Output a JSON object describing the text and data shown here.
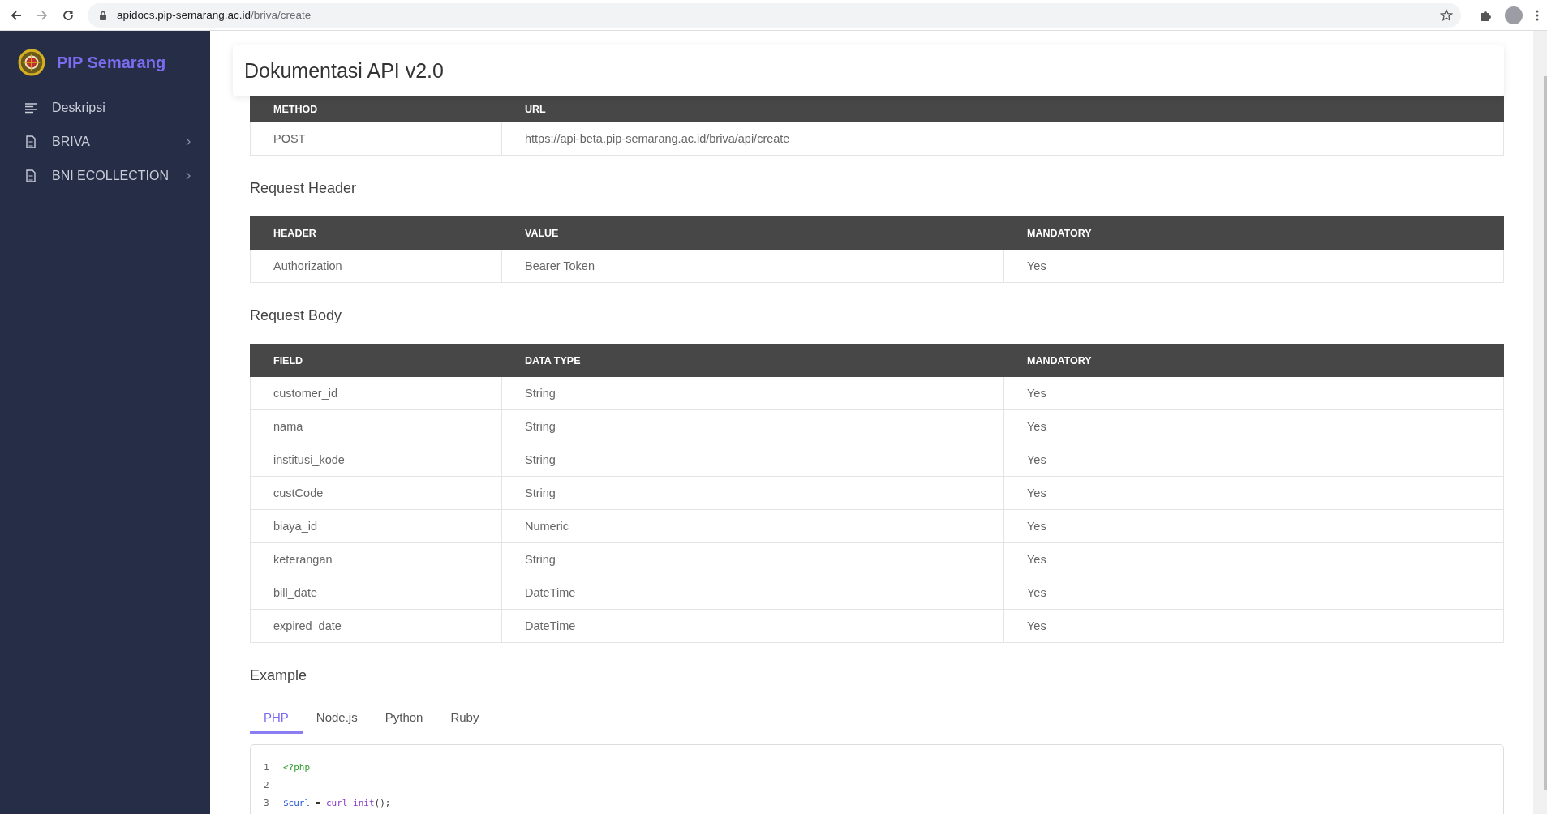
{
  "browser": {
    "url_host": "apidocs.pip-semarang.ac.id",
    "url_path": "/briva/create"
  },
  "sidebar": {
    "brand": "PIP Semarang",
    "items": [
      {
        "label": "Deskripsi",
        "kind": "lines",
        "expandable": false
      },
      {
        "label": "BRIVA",
        "kind": "doc",
        "expandable": true
      },
      {
        "label": "BNI ECOLLECTION",
        "kind": "doc",
        "expandable": true
      }
    ]
  },
  "header": {
    "title": "Dokumentasi API v2.0"
  },
  "sections": [
    {
      "columns": [
        "METHOD",
        "URL"
      ],
      "rows": [
        [
          "POST",
          "https://api-beta.pip-semarang.ac.id/briva/api/create"
        ]
      ]
    },
    {
      "title": "Request Header",
      "columns": [
        "HEADER",
        "VALUE",
        "MANDATORY"
      ],
      "rows": [
        [
          "Authorization",
          "Bearer Token",
          "Yes"
        ]
      ]
    },
    {
      "title": "Request Body",
      "columns": [
        "FIELD",
        "DATA TYPE",
        "MANDATORY"
      ],
      "rows": [
        [
          "customer_id",
          "String",
          "Yes"
        ],
        [
          "nama",
          "String",
          "Yes"
        ],
        [
          "institusi_kode",
          "String",
          "Yes"
        ],
        [
          "custCode",
          "String",
          "Yes"
        ],
        [
          "biaya_id",
          "Numeric",
          "Yes"
        ],
        [
          "keterangan",
          "String",
          "Yes"
        ],
        [
          "bill_date",
          "DateTime",
          "Yes"
        ],
        [
          "expired_date",
          "DateTime",
          "Yes"
        ]
      ]
    }
  ],
  "example": {
    "title": "Example",
    "tabs": [
      {
        "label": "PHP",
        "selected": true
      },
      {
        "label": "Node.js",
        "selected": false
      },
      {
        "label": "Python",
        "selected": false
      },
      {
        "label": "Ruby",
        "selected": false
      }
    ],
    "code": [
      {
        "number": "1",
        "tokens": [
          {
            "kind": "tag",
            "text": "<?php"
          }
        ]
      },
      {
        "number": "2"
      },
      {
        "number": "3",
        "tokens": [
          {
            "kind": "var",
            "text": "$curl"
          },
          {
            "kind": "plain",
            "text": " = "
          },
          {
            "kind": "func",
            "text": "curl_init"
          },
          {
            "kind": "plain",
            "text": "();"
          }
        ]
      }
    ]
  }
}
